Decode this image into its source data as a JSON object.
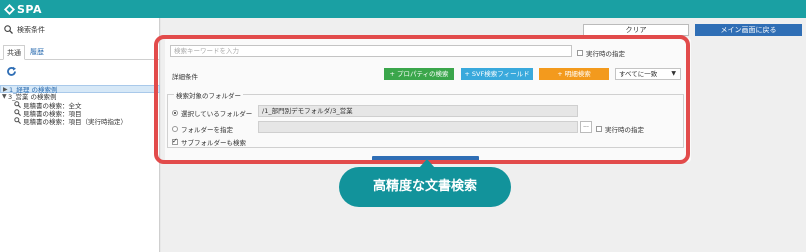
{
  "app": {
    "name": "SPA",
    "brand_color": "#1aa0a3",
    "logo_icon": "spa-logo-icon"
  },
  "sidebar": {
    "search_label": "検索条件",
    "tabs": [
      {
        "label": "共通",
        "active": true
      },
      {
        "label": "履歴",
        "active": false
      }
    ],
    "refresh_icon": "refresh-icon",
    "tree": [
      {
        "label": "1_経理 の検索例",
        "expanded": false,
        "selected": true
      },
      {
        "label": "3_営業 の検索例",
        "expanded": true,
        "selected": false,
        "children": [
          {
            "label": "見積書の検索：全文"
          },
          {
            "label": "見積書の検索：項目"
          },
          {
            "label": "見積書の検索：項目（実行時指定）"
          }
        ]
      }
    ]
  },
  "toolbar": {
    "clear_label": "クリア",
    "main_label": "メイン画面に戻る",
    "main_color": "#2f6eb5"
  },
  "search": {
    "keyword_placeholder": "検索キーワードを入力",
    "runtime_label": "実行時の指定",
    "detail_label": "詳細条件",
    "buttons": [
      {
        "label": "+ プロパティの検索",
        "color": "#3aa64b"
      },
      {
        "label": "+ SVF検索フィールド",
        "color": "#39a9dc"
      },
      {
        "label": "+ 明細検索",
        "color": "#f39a1d"
      }
    ],
    "match_select": "すべてに一致",
    "folder_legend": "検索対象のフォルダー",
    "radio_selected_label": "選択しているフォルダー",
    "selected_path": "/1_部門別デモフォルダ/3_営業",
    "radio_specify_label": "フォルダーを指定",
    "dots_label": "...",
    "specify_runtime_label": "実行時の指定",
    "subfolder_label": "サブフォルダーも検索"
  },
  "callout": {
    "text": "高精度な文書検索",
    "color": "#12939b",
    "highlight_color": "#e24b4b"
  }
}
